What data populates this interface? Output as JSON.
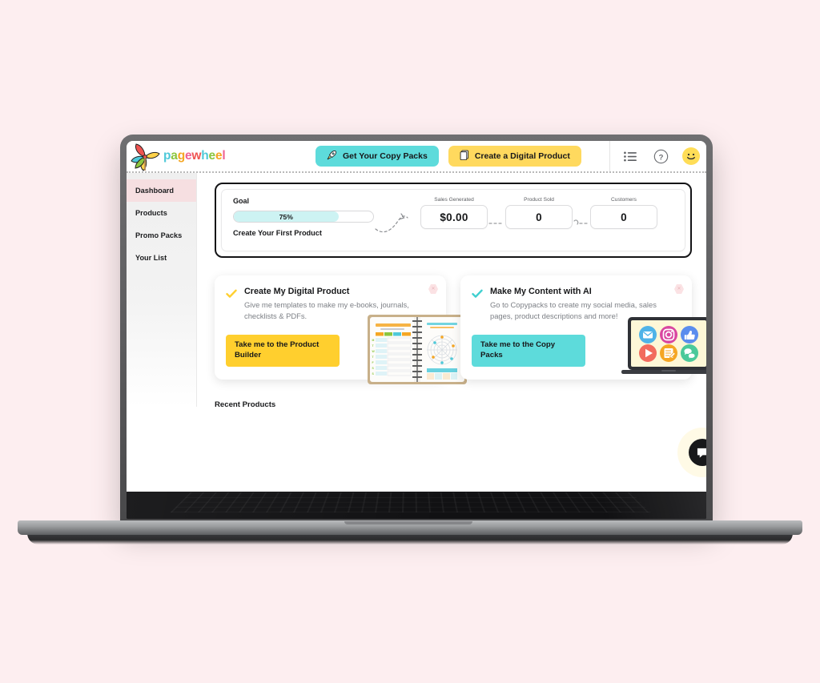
{
  "background_color": "#fdeef0",
  "brand": {
    "name_parts": [
      {
        "text": "p",
        "color": "#4fc9d9"
      },
      {
        "text": "a",
        "color": "#8cc63f"
      },
      {
        "text": "g",
        "color": "#f5a623"
      },
      {
        "text": "e",
        "color": "#f06292"
      },
      {
        "text": "w",
        "color": "#ef5350"
      },
      {
        "text": "h",
        "color": "#4fc9d9"
      },
      {
        "text": "e",
        "color": "#8cc63f"
      },
      {
        "text": "e",
        "color": "#f5a623"
      },
      {
        "text": "l",
        "color": "#f06292"
      }
    ],
    "logo_icon": "pinwheel-icon"
  },
  "header": {
    "copy_packs_button": "Get Your Copy Packs",
    "copy_packs_icon": "rocket-icon",
    "copy_packs_color": "#5ddbdb",
    "digital_product_button": "Create a Digital Product",
    "digital_product_icon": "document-icon",
    "digital_product_color": "#ffd95e",
    "list_icon": "list-icon",
    "help_icon": "help-circle-icon",
    "avatar_icon": "smiley-face-avatar",
    "avatar_color": "#ffdd57"
  },
  "sidebar": {
    "items": [
      {
        "label": "Dashboard",
        "active": true
      },
      {
        "label": "Products",
        "active": false
      },
      {
        "label": "Promo Packs",
        "active": false
      },
      {
        "label": "Your List",
        "active": false
      }
    ],
    "active_background": "#f6dfe1"
  },
  "goal": {
    "title": "Goal",
    "progress_percent": 75,
    "progress_label": "75%",
    "progress_fill_color": "#cdf3f3",
    "subtitle": "Create Your First Product",
    "stats": [
      {
        "label": "Sales Generated",
        "value": "$0.00"
      },
      {
        "label": "Product Sold",
        "value": "0"
      },
      {
        "label": "Customers",
        "value": "0"
      }
    ]
  },
  "promo_cards": [
    {
      "title": "Create My Digital Product",
      "description": "Give me templates to make my e-books, journals, checklists & PDFs.",
      "cta": "Take me to the Product Builder",
      "cta_color": "#ffcf2e",
      "check_color": "#ffcf2e",
      "close_icon": "close-icon",
      "art": "spiral-planner-illustration"
    },
    {
      "title": "Make My Content with AI",
      "description": "Go to Copypacks to create my social media, sales pages, product descriptions and more!",
      "cta": "Take me to the Copy Packs",
      "cta_color": "#5ddbdb",
      "check_color": "#3ecfcf",
      "close_icon": "close-icon",
      "art": "laptop-social-icons-illustration",
      "social_icons": [
        {
          "name": "email-icon",
          "color": "#4fb3e8"
        },
        {
          "name": "instagram-icon",
          "color": "#d946a0"
        },
        {
          "name": "thumbs-up-icon",
          "color": "#5b8dee"
        },
        {
          "name": "play-icon",
          "color": "#f26b5e"
        },
        {
          "name": "note-icon",
          "color": "#f5a623"
        },
        {
          "name": "chat-icon",
          "color": "#4bc99a"
        }
      ]
    }
  ],
  "recent": {
    "title": "Recent Products"
  },
  "chat_widget": {
    "icon": "chat-bubble-icon"
  }
}
